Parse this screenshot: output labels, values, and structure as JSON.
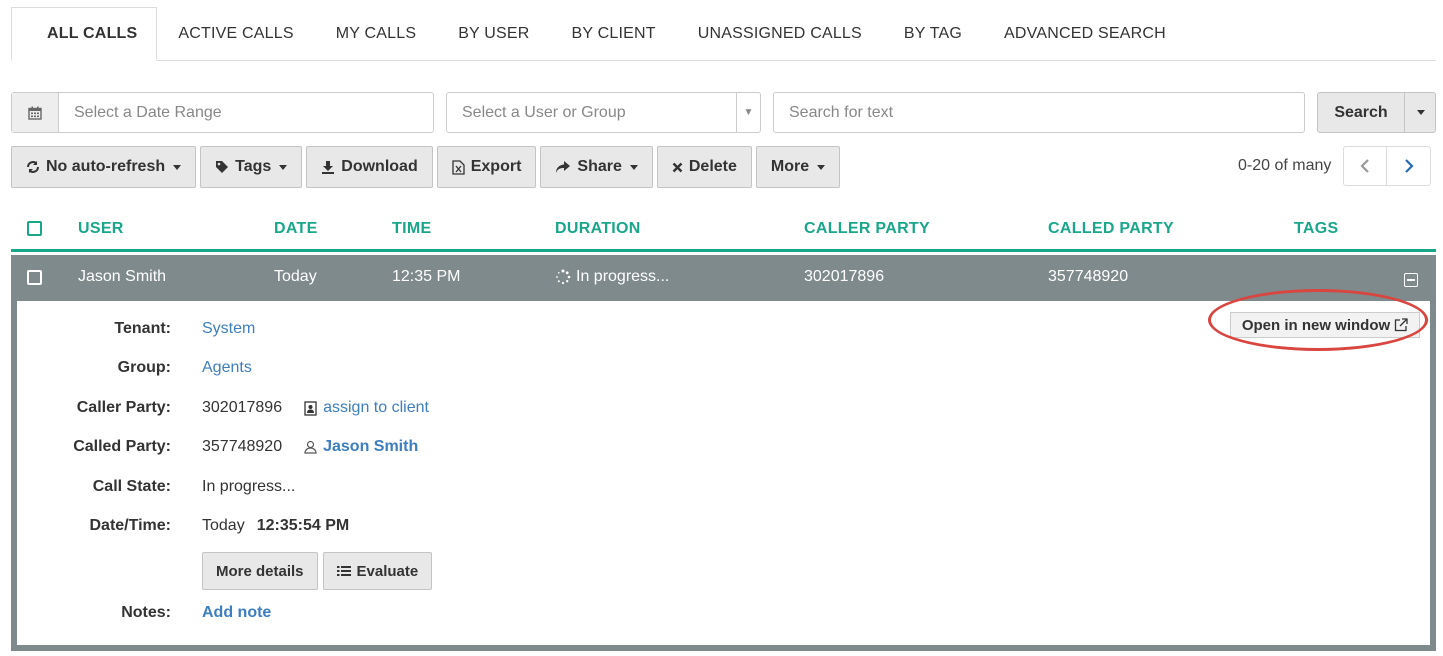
{
  "tabs": [
    {
      "label": "ALL CALLS",
      "active": true
    },
    {
      "label": "ACTIVE CALLS"
    },
    {
      "label": "MY CALLS"
    },
    {
      "label": "BY USER"
    },
    {
      "label": "BY CLIENT"
    },
    {
      "label": "UNASSIGNED CALLS"
    },
    {
      "label": "BY TAG"
    },
    {
      "label": "ADVANCED SEARCH"
    }
  ],
  "filters": {
    "date_placeholder": "Select a Date Range",
    "user_placeholder": "Select a User or Group",
    "search_placeholder": "Search for text",
    "search_label": "Search"
  },
  "toolbar": {
    "refresh_label": "No auto-refresh",
    "tags_label": "Tags",
    "download_label": "Download",
    "export_label": "Export",
    "share_label": "Share",
    "delete_label": "Delete",
    "more_label": "More"
  },
  "pager": {
    "text": "0-20 of many"
  },
  "table": {
    "headers": [
      "USER",
      "DATE",
      "TIME",
      "DURATION",
      "CALLER PARTY",
      "CALLED PARTY",
      "TAGS"
    ],
    "row": {
      "user": "Jason Smith",
      "date": "Today",
      "time": "12:35 PM",
      "duration": "In progress...",
      "caller": "302017896",
      "called": "357748920"
    }
  },
  "detail": {
    "tenant_label": "Tenant:",
    "tenant_value": "System",
    "group_label": "Group:",
    "group_value": "Agents",
    "caller_label": "Caller Party:",
    "caller_value": "302017896",
    "assign_link": "assign to client",
    "called_label": "Called Party:",
    "called_value": "357748920",
    "called_user": "Jason Smith",
    "state_label": "Call State:",
    "state_value": "In progress...",
    "datetime_label": "Date/Time:",
    "datetime_day": "Today",
    "datetime_time": "12:35:54 PM",
    "more_details_label": "More details",
    "evaluate_label": "Evaluate",
    "notes_label": "Notes:",
    "add_note_label": "Add note",
    "open_window_label": "Open in new window"
  },
  "colors": {
    "accent": "#1aa68a",
    "row_bg": "#7e8a8b",
    "link": "#3d7ebf",
    "highlight": "#d9453f"
  }
}
